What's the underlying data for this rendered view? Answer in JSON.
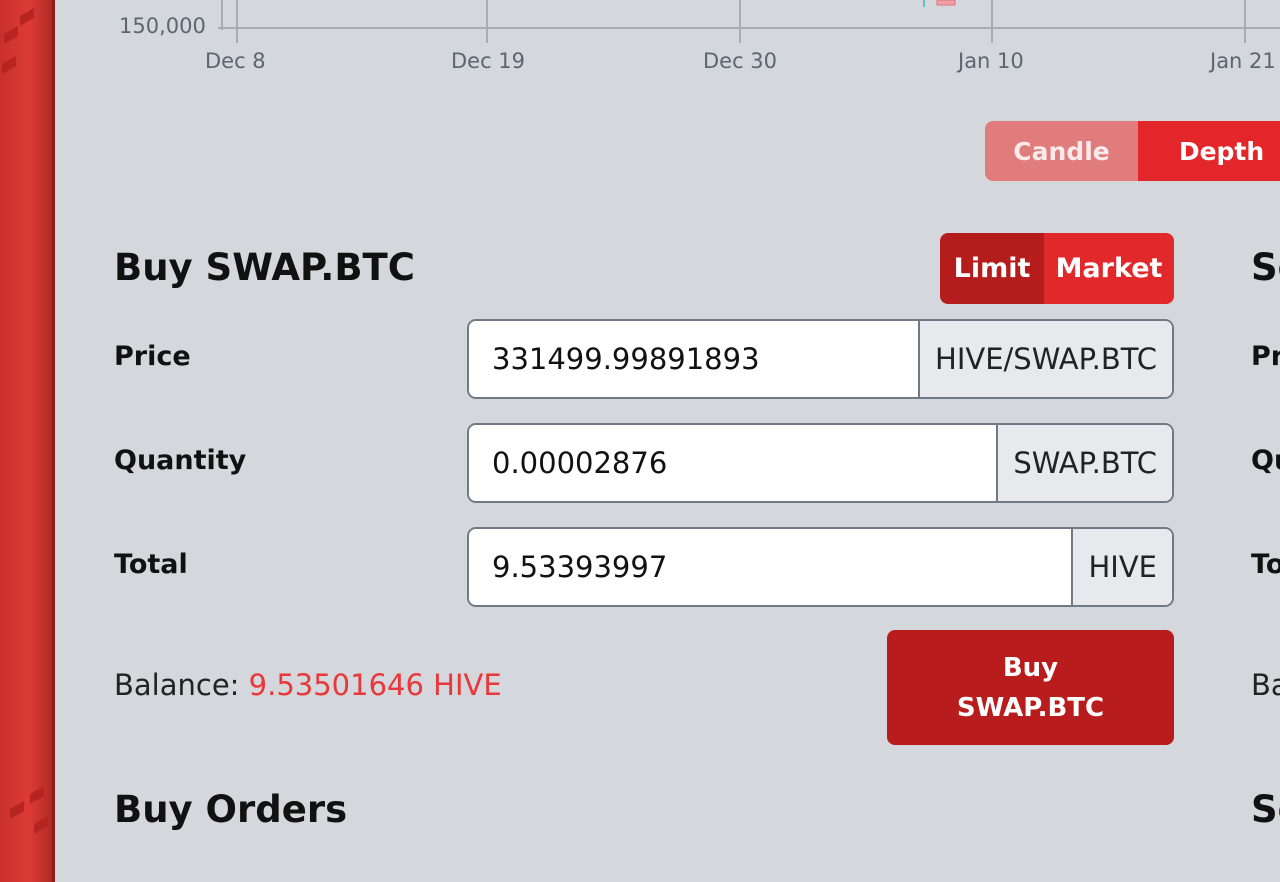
{
  "chart": {
    "y_label": "150,000",
    "x_ticks": [
      "Dec 8",
      "Dec 19",
      "Dec 30",
      "Jan 10",
      "Jan 21"
    ]
  },
  "chart_toggle": {
    "candle": "Candle",
    "depth": "Depth",
    "active": "Depth"
  },
  "buy_panel": {
    "title": "Buy SWAP.BTC",
    "order_types": {
      "limit": "Limit",
      "market": "Market",
      "active": "Limit"
    },
    "price": {
      "label": "Price",
      "value": "331499.99891893",
      "unit": "HIVE/SWAP.BTC"
    },
    "quantity": {
      "label": "Quantity",
      "value": "0.00002876",
      "unit": "SWAP.BTC"
    },
    "total": {
      "label": "Total",
      "value": "9.53393997",
      "unit": "HIVE"
    },
    "balance_label": "Balance:",
    "balance_value": "9.53501646 HIVE",
    "submit_line1": "Buy",
    "submit_line2": "SWAP.BTC"
  },
  "orders": {
    "title": "Buy Orders"
  },
  "sell_panel_clipped": {
    "title": "Se",
    "price_label": "Pr",
    "quantity_label": "Qu",
    "total_label": "To",
    "balance_label": "Ba",
    "orders_title": "Se"
  },
  "colors": {
    "accent_red": "#e3262a",
    "dark_red": "#b91c1c",
    "balance_red": "#e8383b",
    "background": "#d4d7dc"
  }
}
